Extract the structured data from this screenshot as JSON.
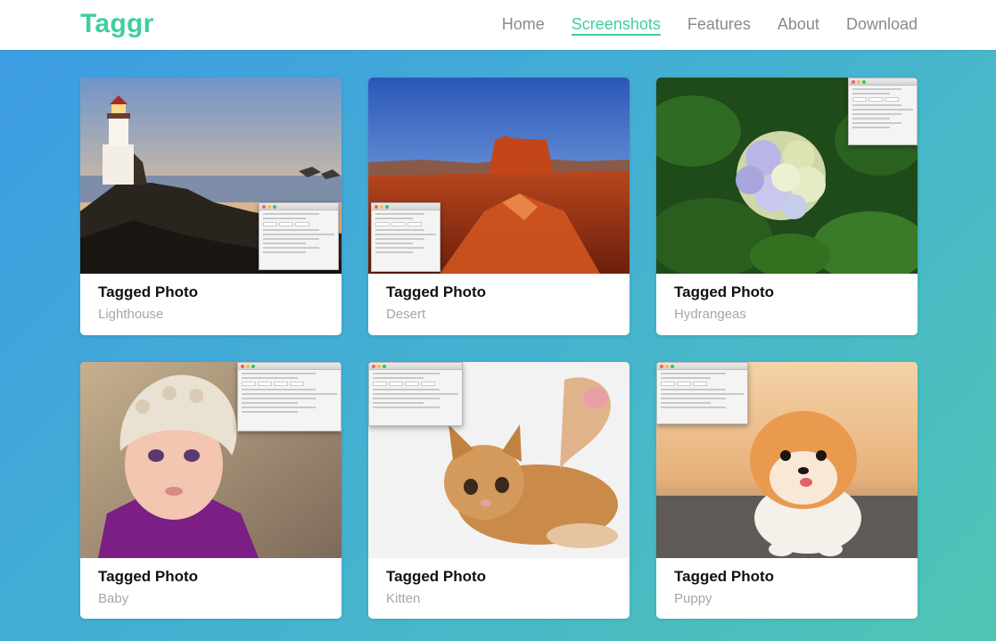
{
  "brand": "Taggr",
  "nav": [
    {
      "label": "Home",
      "active": false
    },
    {
      "label": "Screenshots",
      "active": true
    },
    {
      "label": "Features",
      "active": false
    },
    {
      "label": "About",
      "active": false
    },
    {
      "label": "Download",
      "active": false
    }
  ],
  "cards": [
    {
      "title": "Tagged Photo",
      "subtitle": "Lighthouse",
      "icon": "photo-thumbnail"
    },
    {
      "title": "Tagged Photo",
      "subtitle": "Desert",
      "icon": "photo-thumbnail"
    },
    {
      "title": "Tagged Photo",
      "subtitle": "Hydrangeas",
      "icon": "photo-thumbnail"
    },
    {
      "title": "Tagged Photo",
      "subtitle": "Baby",
      "icon": "photo-thumbnail"
    },
    {
      "title": "Tagged Photo",
      "subtitle": "Kitten",
      "icon": "photo-thumbnail"
    },
    {
      "title": "Tagged Photo",
      "subtitle": "Puppy",
      "icon": "photo-thumbnail"
    }
  ],
  "colors": {
    "accent": "#3fcf9a",
    "nav_text": "#8a8a8a",
    "subtitle": "#a6a6a6"
  }
}
